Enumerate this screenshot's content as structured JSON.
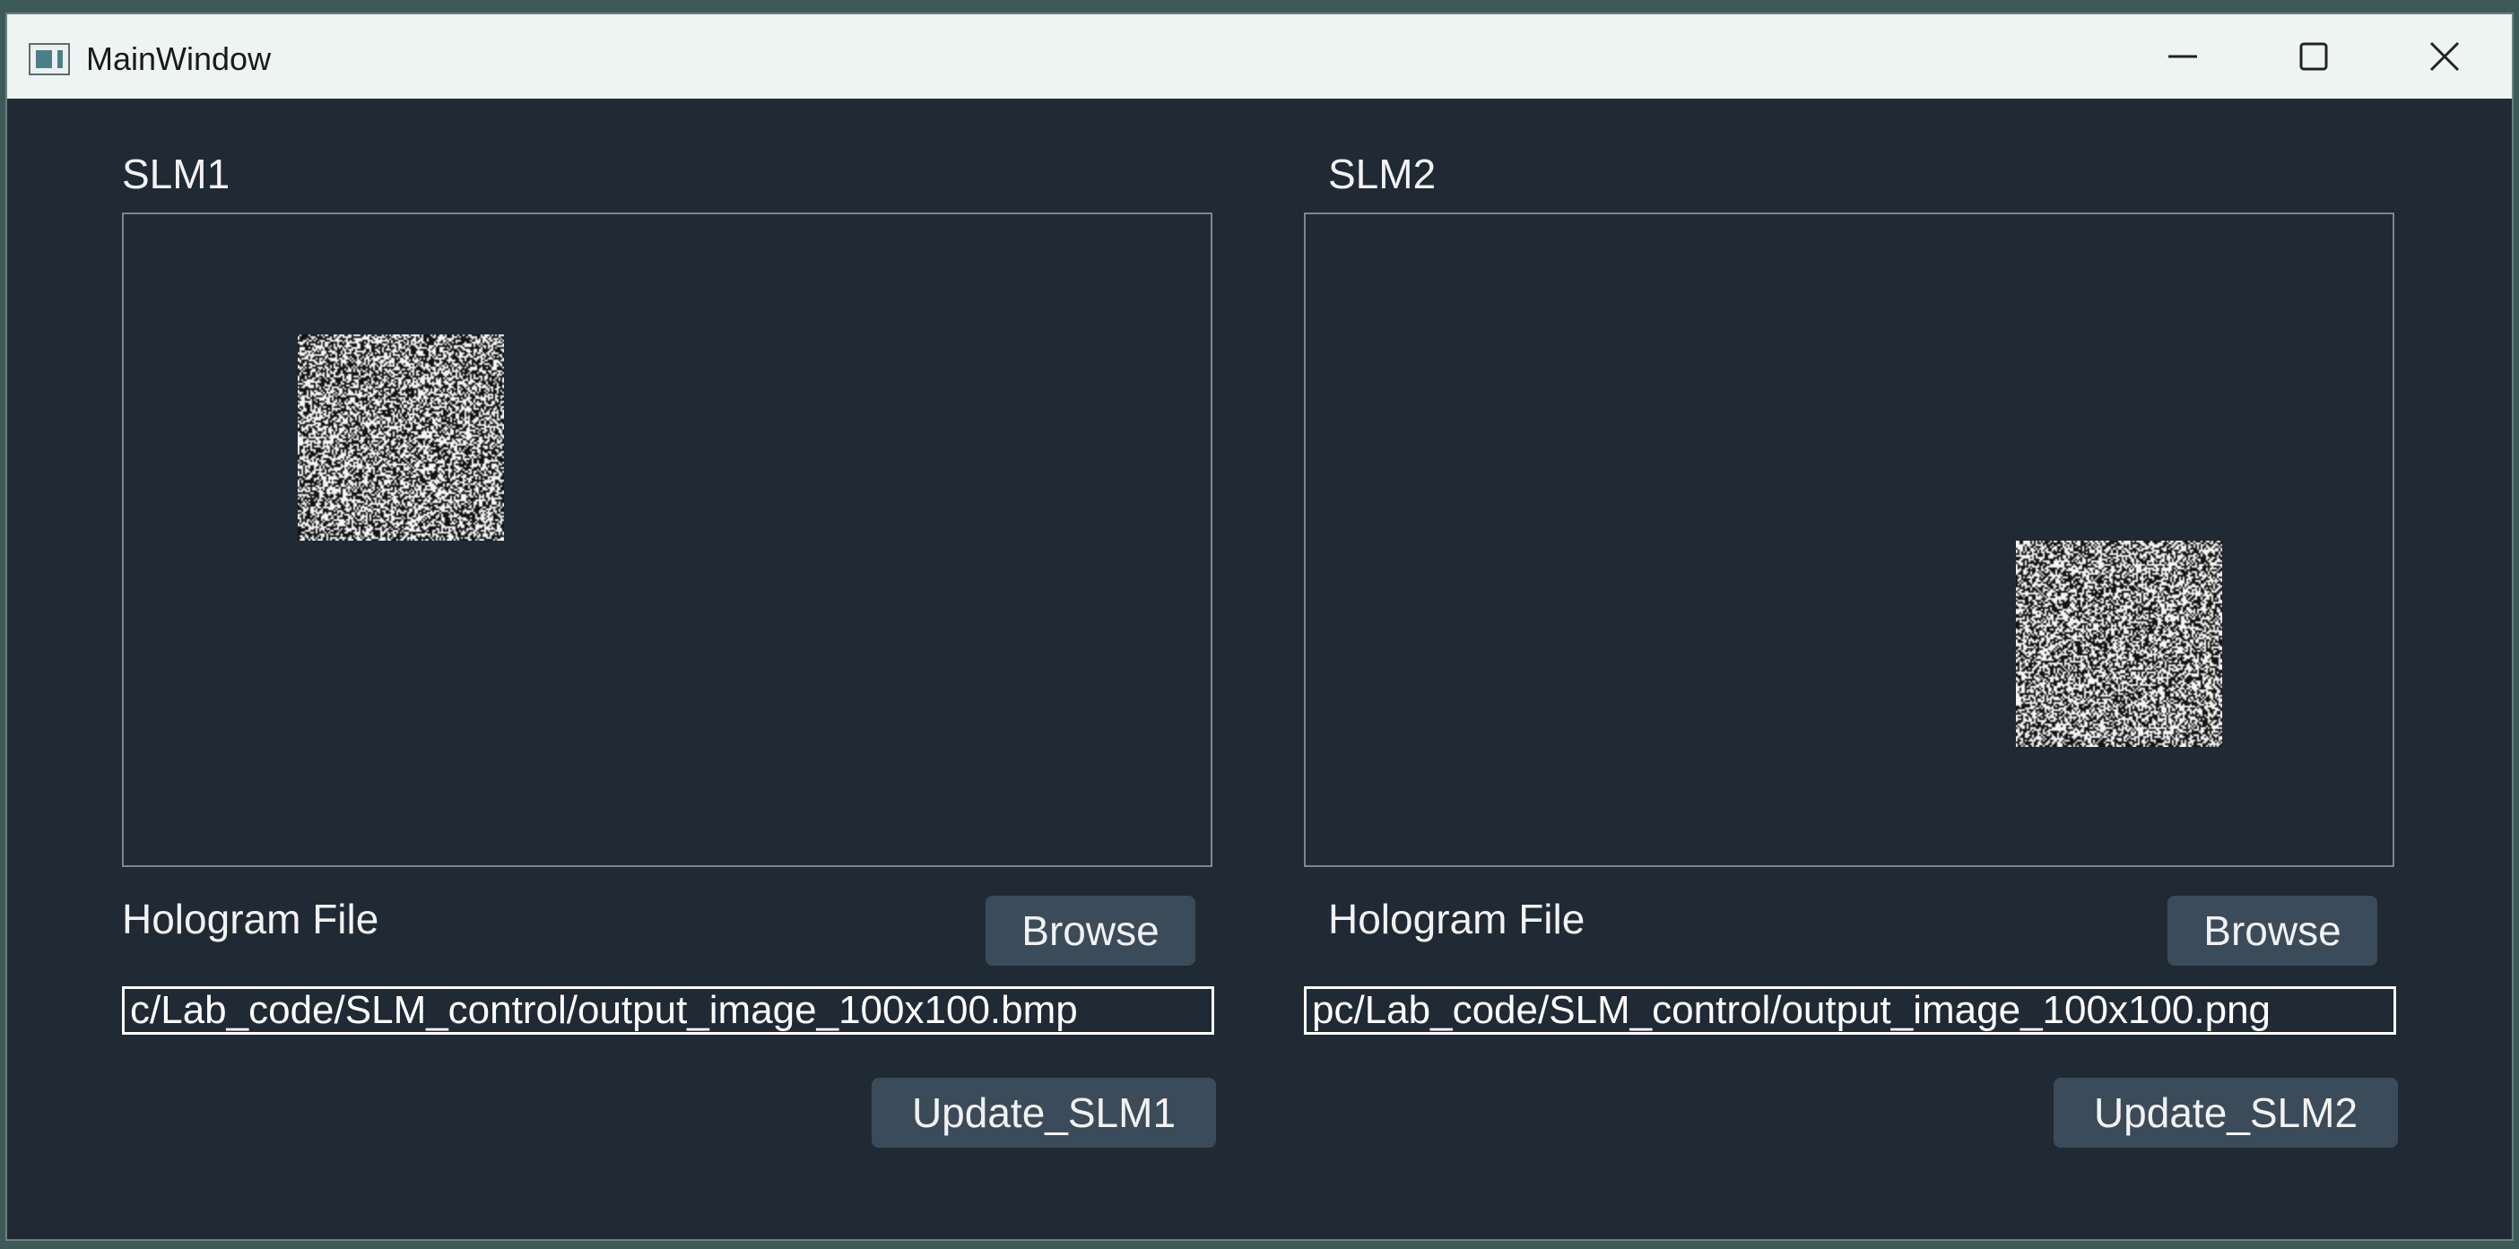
{
  "window": {
    "title": "MainWindow",
    "icon": "app-window-icon",
    "controls": {
      "minimize_icon": "minimize-icon",
      "maximize_icon": "maximize-icon",
      "close_icon": "close-icon"
    }
  },
  "colors": {
    "background": "#202a35",
    "titlebar": "#eef4f2",
    "button": "#3c4b5a",
    "text": "#f2f2f2",
    "viewer_border": "#7d8791"
  },
  "slm1": {
    "label": "SLM1",
    "field_label": "Hologram File",
    "browse_label": "Browse",
    "path_value": "c/Lab_code/SLM_control/output_image_100x100.bmp",
    "update_label": "Update_SLM1"
  },
  "slm2": {
    "label": "SLM2",
    "field_label": "Hologram File",
    "browse_label": "Browse",
    "path_value": "pc/Lab_code/SLM_control/output_image_100x100.png",
    "update_label": "Update_SLM2"
  }
}
